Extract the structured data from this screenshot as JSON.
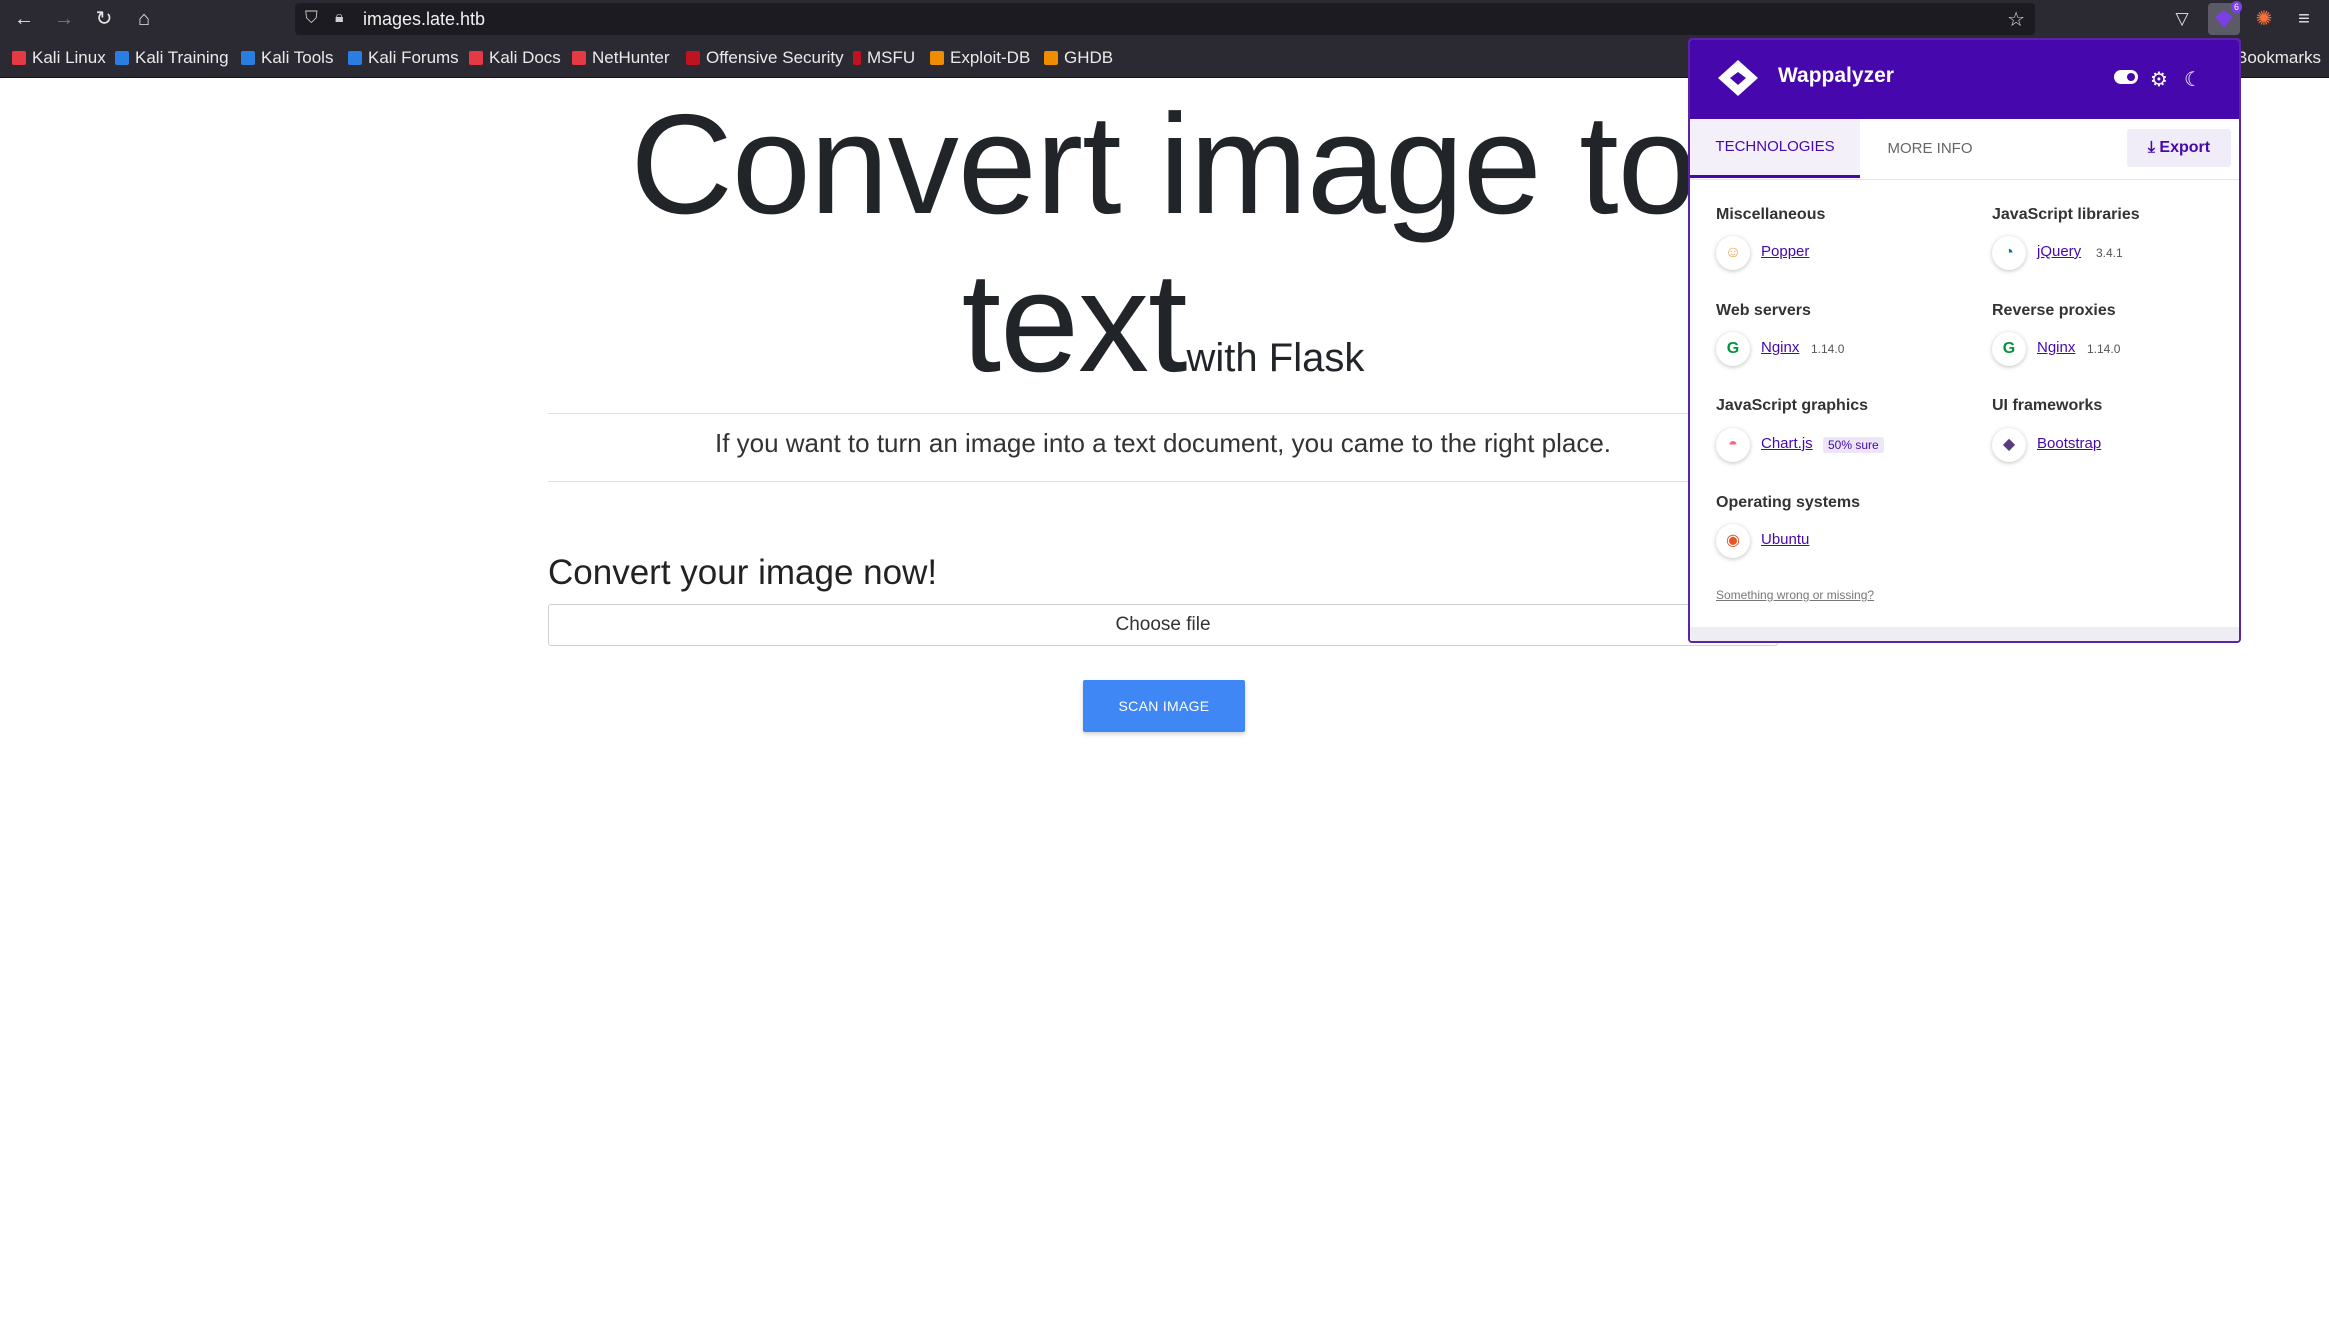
{
  "browser": {
    "url": "images.late.htb",
    "bookmarks": [
      "Kali Linux",
      "Kali Training",
      "Kali Tools",
      "Kali Forums",
      "Kali Docs",
      "NetHunter",
      "Offensive Security",
      "MSFU",
      "Exploit-DB",
      "GHDB"
    ],
    "other_bookmarks": "Bookmarks",
    "extension_badge": "6"
  },
  "page": {
    "title_line1": "Convert image to",
    "title_line2": "text",
    "title_small": "with Flask",
    "lead": "If you want to turn an image into a text document, you came to the right place.",
    "convert_heading": "Convert your image now!",
    "file_label": "Choose file",
    "scan_button": "SCAN IMAGE"
  },
  "wappalyzer": {
    "title": "Wappalyzer",
    "tabs": {
      "technologies": "TECHNOLOGIES",
      "more_info": "MORE INFO"
    },
    "export": "Export",
    "categories": [
      {
        "name": "Miscellaneous",
        "tech": "Popper",
        "version": "",
        "badge": ""
      },
      {
        "name": "JavaScript libraries",
        "tech": "jQuery",
        "version": "3.4.1",
        "badge": ""
      },
      {
        "name": "Web servers",
        "tech": "Nginx",
        "version": "1.14.0",
        "badge": ""
      },
      {
        "name": "Reverse proxies",
        "tech": "Nginx",
        "version": "1.14.0",
        "badge": ""
      },
      {
        "name": "JavaScript graphics",
        "tech": "Chart.js",
        "version": "",
        "badge": "50% sure"
      },
      {
        "name": "UI frameworks",
        "tech": "Bootstrap",
        "version": "",
        "badge": ""
      },
      {
        "name": "Operating systems",
        "tech": "Ubuntu",
        "version": "",
        "badge": ""
      }
    ],
    "footer_link": "Something wrong or missing?"
  },
  "colors": {
    "toolbar_bg": "#2b2a33",
    "wappalyzer_purple": "#4608ad",
    "scan_button": "#3f87f5"
  }
}
